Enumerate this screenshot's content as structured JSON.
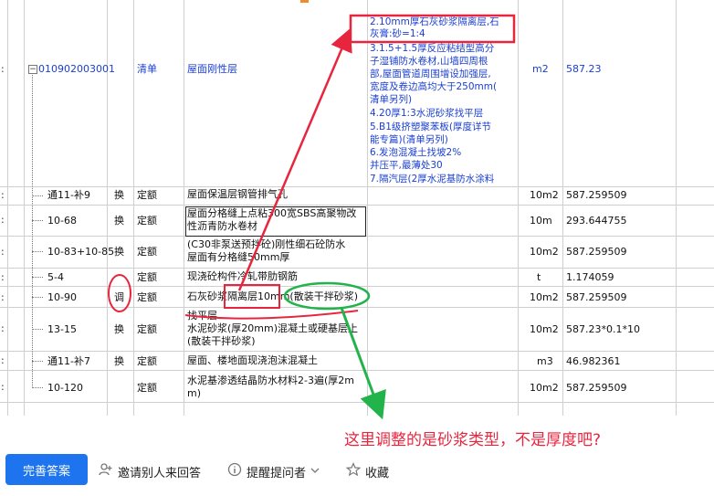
{
  "top_item": {
    "code": "010902003001",
    "type": "清单",
    "name": "屋面刚性层",
    "desc_lines": [
      "2.10mm厚石灰砂浆隔离层,石",
      "灰膏:砂=1:4",
      "3.1.5+1.5厚反应粘结型高分",
      "子湿铺防水卷材,山墙四周根",
      "部,屋面管道周围增设加强层,",
      "宽度及卷边高均大于250mm(",
      "清单另列)",
      "4.20厚1:3水泥砂浆找平层",
      "5.B1级挤塑聚苯板(厚度详节",
      "能专篇)(清单另列)",
      "6.发泡混凝土找坡2%",
      "并压平,最薄处30",
      "7.隔汽层(2厚水泥基防水涂料"
    ],
    "unit": "m2",
    "qty": "587.23"
  },
  "rows": [
    {
      "code": "通11-补9",
      "flag": "换",
      "type": "定额",
      "name_lines": [
        "屋面保温层钢管排气孔"
      ],
      "unit": "10m2",
      "qty": "587.259509"
    },
    {
      "code": "10-68",
      "flag": "换",
      "type": "定额",
      "name_lines": [
        "屋面分格缝上点粘300宽SBS高聚物改",
        "性沥青防水卷材"
      ],
      "unit": "10m",
      "qty": "293.644755"
    },
    {
      "code": "10-83+10-85",
      "flag": "换",
      "type": "定额",
      "name_lines": [
        "(C30非泵送预拌砼)刚性细石砼防水",
        "屋面有分格缝50mm厚"
      ],
      "unit": "10m2",
      "qty": "587.259509"
    },
    {
      "code": "5-4",
      "flag": "",
      "type": "定额",
      "name_lines": [
        "现浇砼构件冷轧带肋钢筋"
      ],
      "unit": "t",
      "qty": "1.174059"
    },
    {
      "code": "10-90",
      "flag": "调",
      "type": "定额",
      "name_lines": [
        "石灰砂浆隔离层10mm(散装干拌砂浆)"
      ],
      "unit": "10m2",
      "qty": "587.259509"
    },
    {
      "code": "13-15",
      "flag": "换",
      "type": "定额",
      "name_lines": [
        "找平层",
        "水泥砂浆(厚20mm)混凝土或硬基层上",
        "(散装干拌砂浆)"
      ],
      "unit": "10m2",
      "qty": "587.23*0.1*10"
    },
    {
      "code": "通11-补7",
      "flag": "换",
      "type": "定额",
      "name_lines": [
        "屋面、楼地面现浇泡沫混凝土"
      ],
      "unit": "m3",
      "qty": "46.982361"
    },
    {
      "code": "10-120",
      "flag": "",
      "type": "定额",
      "name_lines": [
        "水泥基渗透结晶防水材料2-3遍(厚2m",
        "m)"
      ],
      "unit": "10m2",
      "qty": "587.259509"
    }
  ],
  "annotation_text": "这里调整的是砂浆类型，不是厚度吧?",
  "actions": {
    "answer": "完善答案",
    "invite": "邀请别人来回答",
    "remind": "提醒提问者",
    "collect": "收藏"
  },
  "colors": {
    "accent": "#1e74ee",
    "annotation": "#e7263e",
    "highlight": "#22b34a",
    "link": "#1a3fd0"
  }
}
